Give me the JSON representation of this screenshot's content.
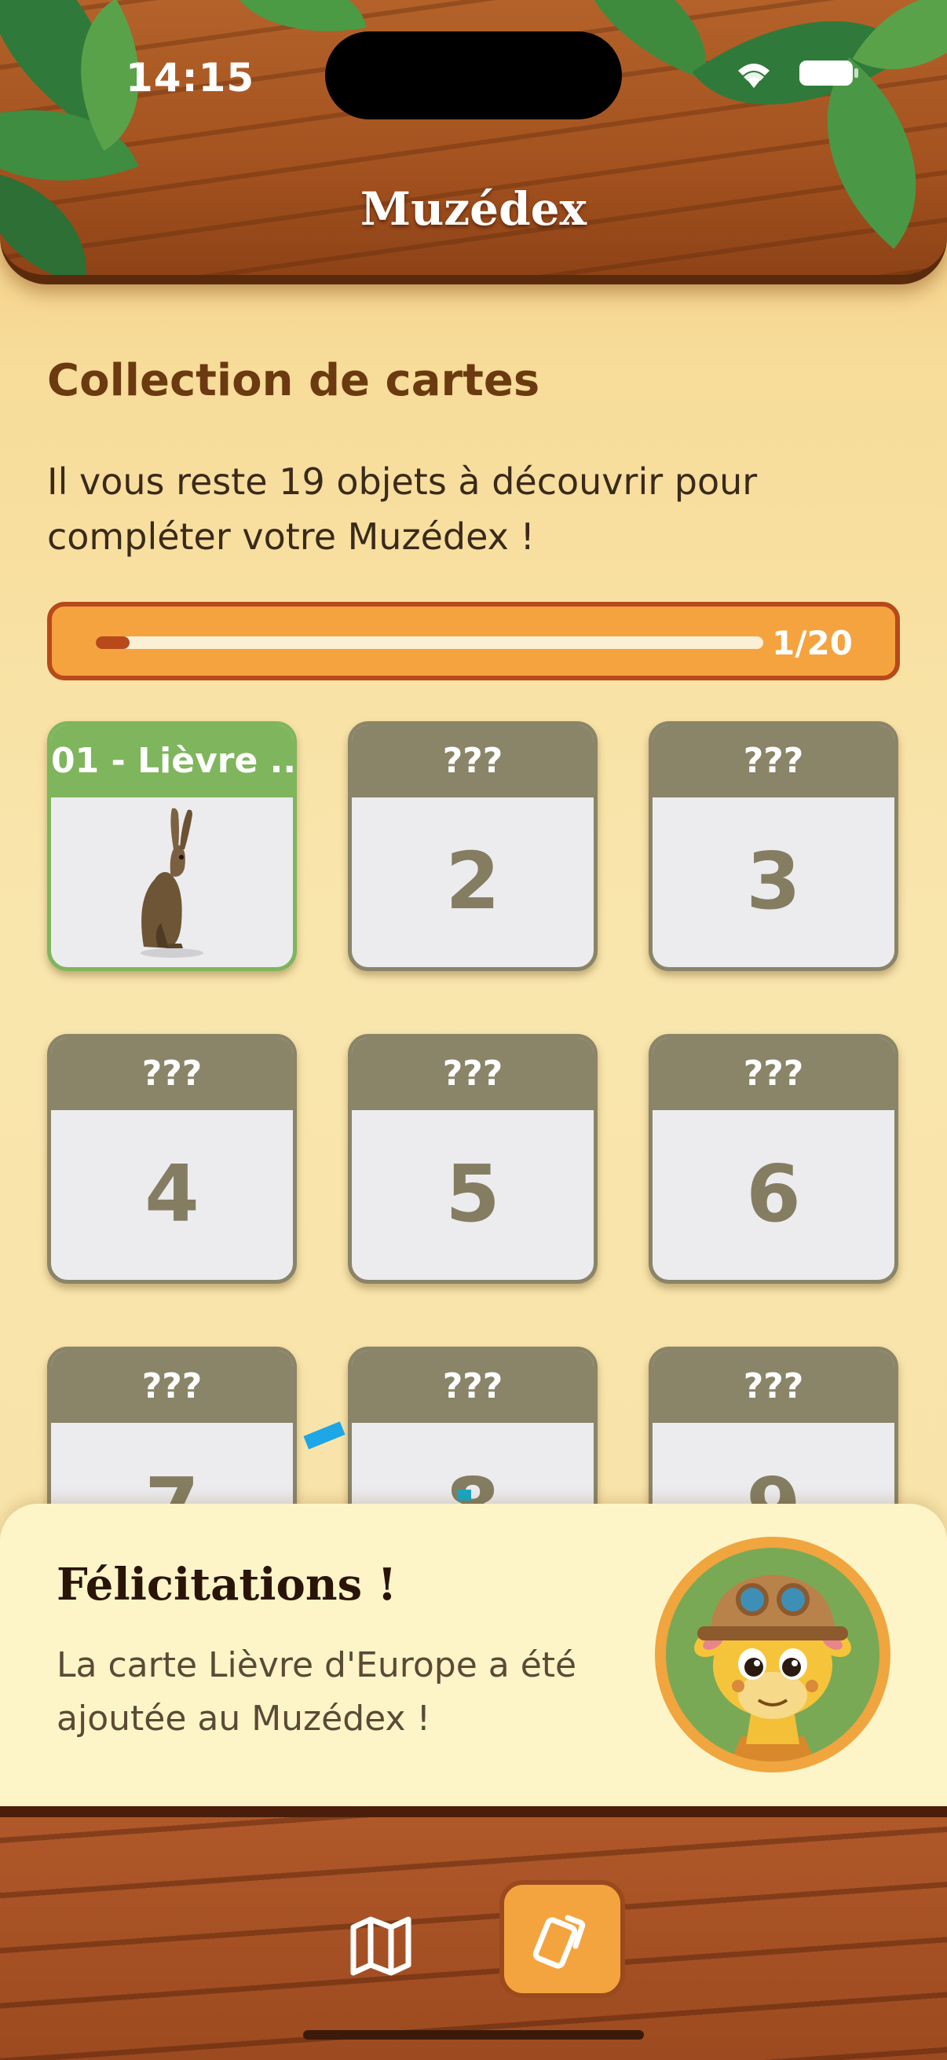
{
  "status_bar": {
    "time": "14:15"
  },
  "header": {
    "title": "Muzédex"
  },
  "collection": {
    "title": "Collection de cartes",
    "description": "Il vous reste 19 objets à découvrir pour compléter votre Muzédex !",
    "progress": {
      "collected": 1,
      "total": 20,
      "label": "1/20"
    }
  },
  "cards": [
    {
      "label": "01 - Lièvre ...",
      "number": "",
      "found": true,
      "image": "hare"
    },
    {
      "label": "???",
      "number": "2",
      "found": false
    },
    {
      "label": "???",
      "number": "3",
      "found": false
    },
    {
      "label": "???",
      "number": "4",
      "found": false
    },
    {
      "label": "???",
      "number": "5",
      "found": false
    },
    {
      "label": "???",
      "number": "6",
      "found": false
    },
    {
      "label": "???",
      "number": "7",
      "found": false
    },
    {
      "label": "???",
      "number": "8",
      "found": false
    },
    {
      "label": "???",
      "number": "9",
      "found": false
    }
  ],
  "toast": {
    "title": "Félicitations !",
    "message": "La carte Lièvre d'Europe a été ajoutée au Muzédex !",
    "avatar": "giraffe-explorer"
  },
  "nav": {
    "items": [
      {
        "icon": "map-icon",
        "active": false
      },
      {
        "icon": "cards-icon",
        "active": true
      }
    ]
  },
  "colors": {
    "accent": "#f4a43f",
    "progress_border": "#b7491b",
    "found_card": "#7fb55d",
    "locked_card": "#8a8468",
    "title_brown": "#6b3a10"
  }
}
